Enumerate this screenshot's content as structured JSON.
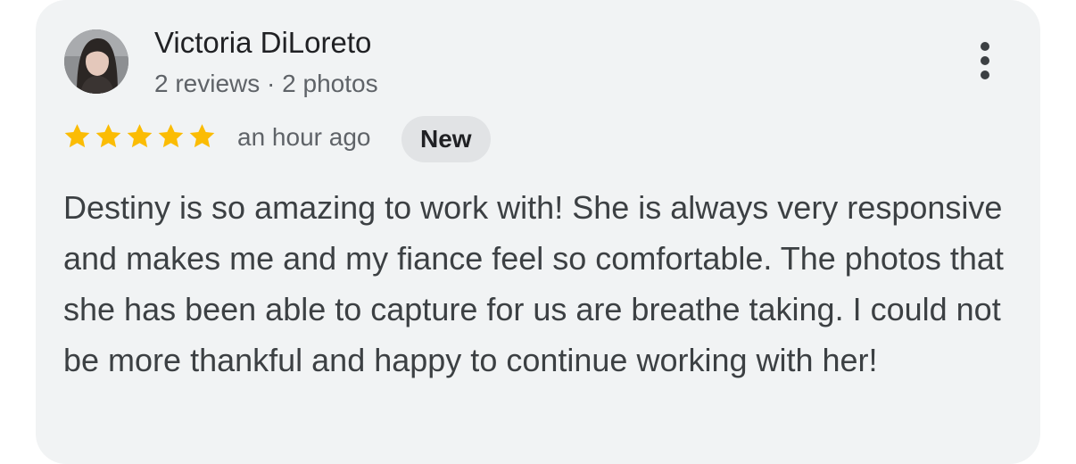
{
  "review": {
    "author_name": "Victoria DiLoreto",
    "author_meta": "2 reviews · 2 photos",
    "rating": 5,
    "rating_max": 5,
    "time": "an hour ago",
    "badge": "New",
    "text": "Destiny is so amazing to work with! She is always very responsive and makes me and my fiance feel so comfortable. The photos that she has been able to capture for us are breathe taking. I could not be more thankful and happy to continue working with her!"
  },
  "icons": {
    "more": "more-vert-icon",
    "star": "star-icon",
    "avatar": "profile-photo"
  },
  "colors": {
    "card_background": "#f1f3f4",
    "star": "#fbbc04",
    "badge_background": "#e1e3e5",
    "primary_text": "#202124",
    "secondary_text": "#5f6368"
  }
}
